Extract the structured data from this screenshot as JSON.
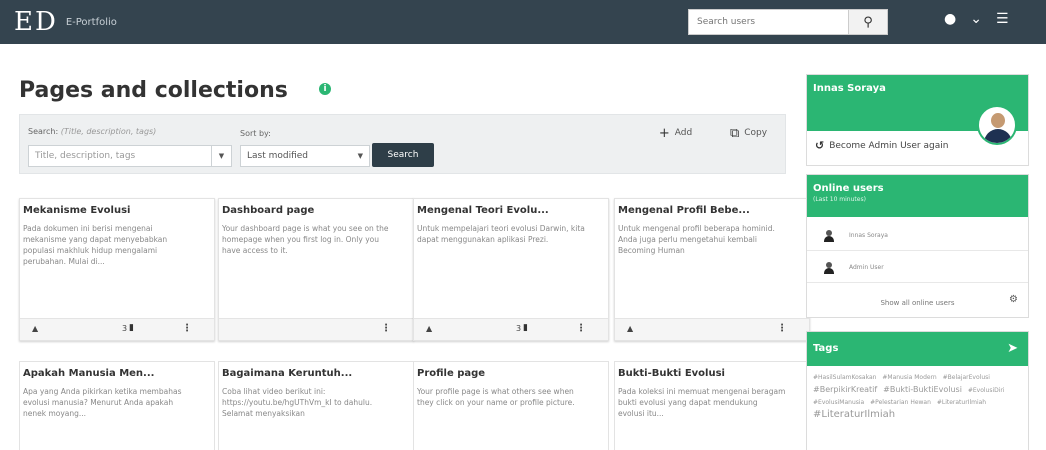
{
  "header": {
    "logo": "ED",
    "logo_sub": "E-Portfolio",
    "search_placeholder": "Search users",
    "search_icon": "search-icon",
    "user_menu_icon": "user-menu-icon",
    "chevron_icon": "chevron-down-icon",
    "menu_icon": "hamburger-menu-icon"
  },
  "page": {
    "title": "Pages and collections"
  },
  "filters": {
    "search_label": "Search:",
    "search_label_hint": "(Title, description, tags)",
    "search_placeholder": "Title, description, tags",
    "sort_label": "Sort by:",
    "sort_value": "Last modified",
    "search_button": "Search",
    "add_label": "Add",
    "copy_label": "Copy"
  },
  "cards": [
    {
      "title": "Mekanisme Evolusi",
      "desc": "Pada dokumen ini berisi mengenai mekanisme yang dapat menyebabkan populasi makhluk hidup mengalami perubahan. Mulai di...",
      "count": "3"
    },
    {
      "title": "Dashboard page",
      "desc": "Your dashboard page is what you see on the homepage when you first log in. Only you have access to it.",
      "count": ""
    },
    {
      "title": "Mengenal Teori Evolu...",
      "desc": "Untuk mempelajari teori evolusi Darwin, kita dapat menggunakan aplikasi Prezi.",
      "count": "3"
    },
    {
      "title": "Mengenal Profil Bebe...",
      "desc": "Untuk mengenal profil beberapa hominid. Anda juga perlu mengetahui kembali Becoming Human",
      "count": ""
    },
    {
      "title": "Apakah Manusia Men...",
      "desc": "Apa yang Anda pikirkan ketika membahas evolusi manusia? Menurut Anda apakah nenek moyang...",
      "count": ""
    },
    {
      "title": "Bagaimana Keruntuh...",
      "desc": "Coba lihat video berikut ini: https://youtu.be/hgUThVm_kI to dahulu. Selamat menyaksikan",
      "count": ""
    },
    {
      "title": "Profile page",
      "desc": "Your profile page is what others see when they click on your name or profile picture.",
      "count": ""
    },
    {
      "title": "Bukti-Bukti Evolusi",
      "desc": "Pada koleksi ini memuat mengenai beragam bukti evolusi yang dapat mendukung evolusi itu...",
      "count": ""
    }
  ],
  "sidebar": {
    "user_name": "Innas Soraya",
    "become_admin": "Become Admin User again",
    "online_title": "Online users",
    "online_subtitle": "(Last 10 minutes)",
    "online_users": [
      "Innas Soraya",
      "Admin User"
    ],
    "show_all": "Show all online users",
    "tags_title": "Tags",
    "tags": [
      {
        "text": "#HasilSulamKosakan",
        "size": 1
      },
      {
        "text": "#Manusia Modern",
        "size": 1
      },
      {
        "text": "#BelajarEvolusi",
        "size": 1
      },
      {
        "text": "#BerpikirKreatif",
        "size": 2
      },
      {
        "text": "#Bukti-BuktiEvolusi",
        "size": 2
      },
      {
        "text": "#EvolusiDiri",
        "size": 1
      },
      {
        "text": "#EvolusiManusia",
        "size": 1
      },
      {
        "text": "#Pelestarian Hewan",
        "size": 1
      },
      {
        "text": "#LiteraturIlmiah",
        "size": 1
      },
      {
        "text": "#LiteraturIlmiah",
        "size": 3
      }
    ]
  }
}
